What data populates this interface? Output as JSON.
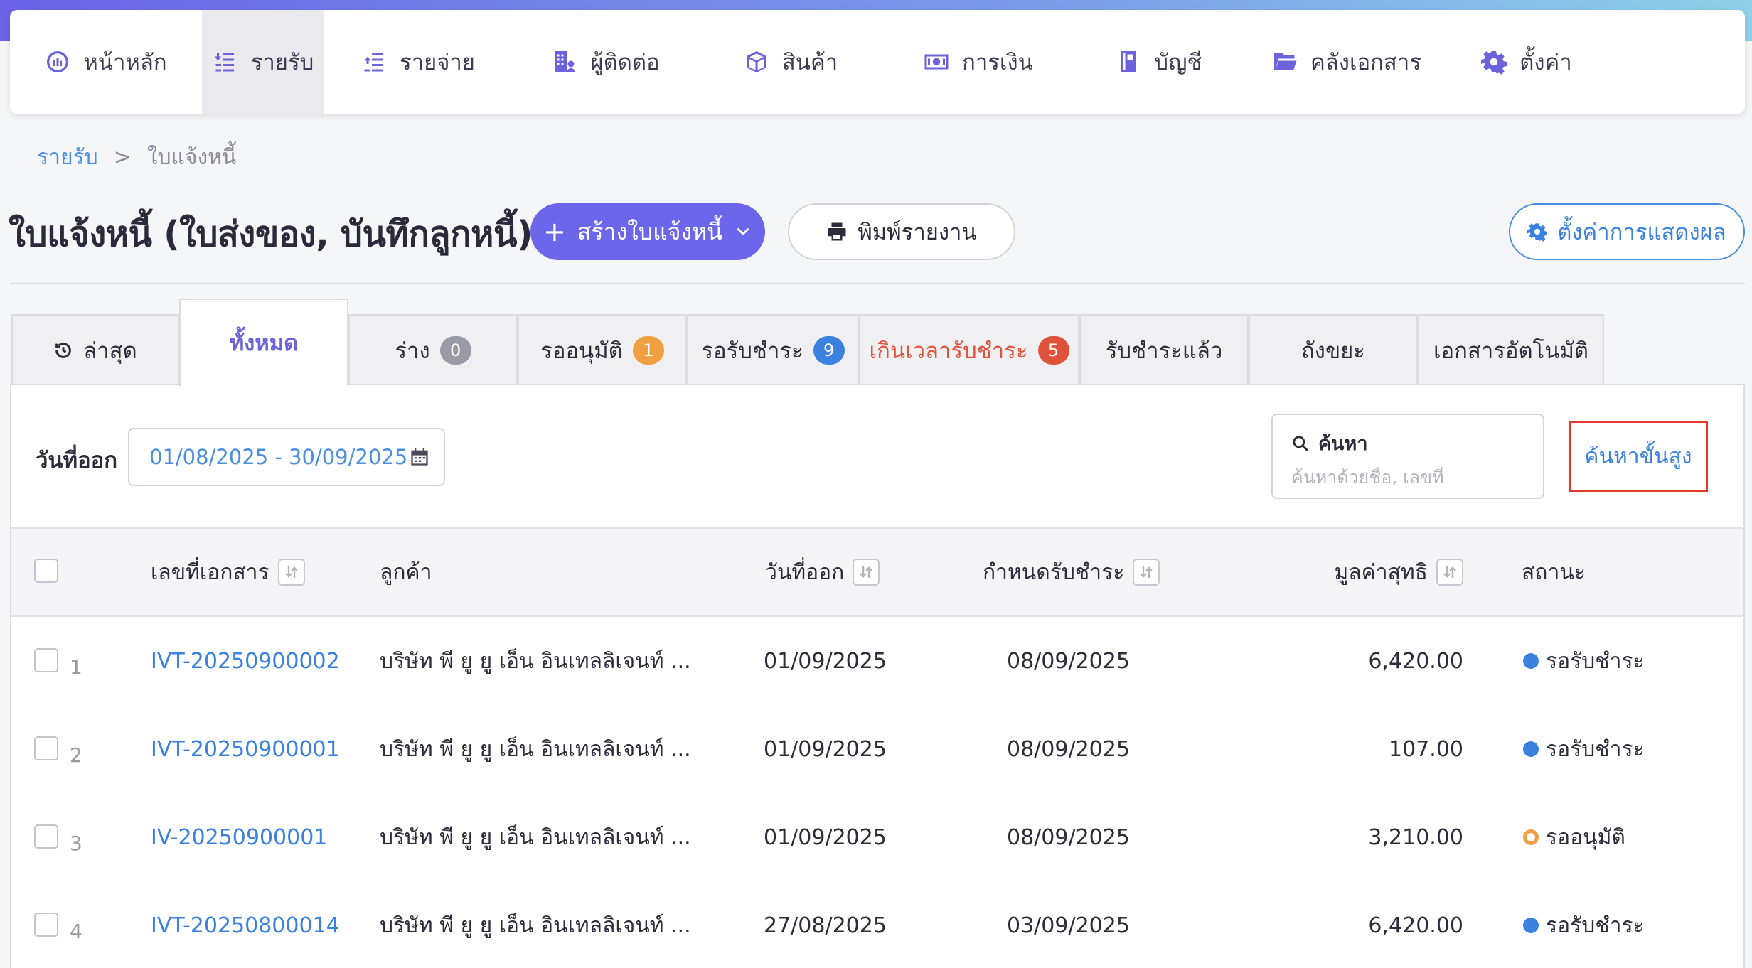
{
  "nav": {
    "items": [
      {
        "label": "หน้าหลัก",
        "icon": "dashboard-icon"
      },
      {
        "label": "รายรับ",
        "icon": "income-icon",
        "active": true
      },
      {
        "label": "รายจ่าย",
        "icon": "expense-icon"
      },
      {
        "label": "ผู้ติดต่อ",
        "icon": "contacts-icon"
      },
      {
        "label": "สินค้า",
        "icon": "product-box-icon"
      },
      {
        "label": "การเงิน",
        "icon": "money-icon"
      },
      {
        "label": "บัญชี",
        "icon": "ledger-icon"
      },
      {
        "label": "คลังเอกสาร",
        "icon": "folder-icon"
      },
      {
        "label": "ตั้งค่า",
        "icon": "gear-icon"
      }
    ]
  },
  "breadcrumb": {
    "parent": "รายรับ",
    "separator": ">",
    "current": "ใบแจ้งหนี้"
  },
  "page": {
    "title": "ใบแจ้งหนี้ (ใบส่งของ, บันทึกลูกหนี้)",
    "create_button": "สร้างใบแจ้งหนี้",
    "print_button": "พิมพ์รายงาน",
    "display_settings_button": "ตั้งค่าการแสดงผล"
  },
  "tabs": [
    {
      "label": "ล่าสุด"
    },
    {
      "label": "ทั้งหมด",
      "active": true
    },
    {
      "label": "ร่าง",
      "badge": "0",
      "badge_color": "#9a9aa6"
    },
    {
      "label": "รออนุมัติ",
      "badge": "1",
      "badge_color": "#f0a040"
    },
    {
      "label": "รอรับชำระ",
      "badge": "9",
      "badge_color": "#3b82e0"
    },
    {
      "label": "เกินเวลารับชำระ",
      "badge": "5",
      "badge_color": "#e0533a",
      "overdue": true
    },
    {
      "label": "รับชำระแล้ว"
    },
    {
      "label": "ถังขยะ"
    },
    {
      "label": "เอกสารอัตโนมัติ"
    }
  ],
  "filters": {
    "date_label": "วันที่ออก",
    "date_range": "01/08/2025 - 30/09/2025",
    "search_label": "ค้นหา",
    "search_placeholder": "ค้นหาด้วยชื่อ, เลขที่",
    "advanced_search": "ค้นหาขั้นสูง"
  },
  "table": {
    "columns": {
      "doc_no": "เลขที่เอกสาร",
      "customer": "ลูกค้า",
      "issue_date": "วันที่ออก",
      "due_date": "กำหนดรับชำระ",
      "net_value": "มูลค่าสุทธิ",
      "status": "สถานะ"
    },
    "rows": [
      {
        "num": "1",
        "doc_no": "IVT-20250900002",
        "customer": "บริษัท พี ยู ยู เอ็น อินเทลลิเจนท์ ...",
        "issue_date": "01/09/2025",
        "due_date": "08/09/2025",
        "net_value": "6,420.00",
        "status": "รอรับชำระ",
        "status_color": "#3b82e0"
      },
      {
        "num": "2",
        "doc_no": "IVT-20250900001",
        "customer": "บริษัท พี ยู ยู เอ็น อินเทลลิเจนท์ ...",
        "issue_date": "01/09/2025",
        "due_date": "08/09/2025",
        "net_value": "107.00",
        "status": "รอรับชำระ",
        "status_color": "#3b82e0"
      },
      {
        "num": "3",
        "doc_no": "IV-20250900001",
        "customer": "บริษัท พี ยู ยู เอ็น อินเทลลิเจนท์ ...",
        "issue_date": "01/09/2025",
        "due_date": "08/09/2025",
        "net_value": "3,210.00",
        "status": "รออนุมัติ",
        "status_color": "#f0a040"
      },
      {
        "num": "4",
        "doc_no": "IVT-20250800014",
        "customer": "บริษัท พี ยู ยู เอ็น อินเทลลิเจนท์ ...",
        "issue_date": "27/08/2025",
        "due_date": "03/09/2025",
        "net_value": "6,420.00",
        "status": "รอรับชำระ",
        "status_color": "#3b82e0"
      }
    ]
  }
}
